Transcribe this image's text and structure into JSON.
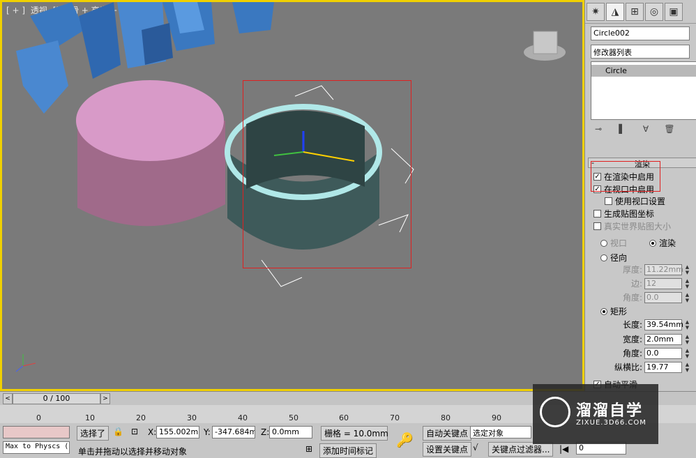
{
  "viewport": {
    "label_parts": [
      "[ + ]",
      "透视",
      "[] 平滑 + 高光 + 边面 ]"
    ],
    "colors": {
      "background": "#7a7a7a",
      "border": "#f0d000",
      "selection": "#e02020"
    }
  },
  "command_panel": {
    "tabs": [
      "create-icon",
      "modify-icon",
      "hierarchy-icon",
      "motion-icon",
      "display-icon",
      "utilities-icon"
    ],
    "object_name": "Circle002",
    "modifier_list": "修改器列表",
    "stack_items": [
      "Circle"
    ],
    "rollout_title": "渲染",
    "checkboxes": [
      {
        "label": "在渲染中启用",
        "checked": true
      },
      {
        "label": "在视口中启用",
        "checked": true
      },
      {
        "label": "使用视口设置",
        "checked": false
      },
      {
        "label": "生成贴图坐标",
        "checked": false
      },
      {
        "label": "真实世界贴图大小",
        "checked": false
      }
    ],
    "mode": {
      "viewport": "视口",
      "render": "渲染"
    },
    "radial": {
      "label": "径向",
      "thickness_label": "厚度:",
      "thickness": "11.22mm",
      "sides_label": "边:",
      "sides": "12",
      "angle_label": "角度:",
      "angle": "0.0"
    },
    "rectangular": {
      "label": "矩形",
      "length_label": "长度:",
      "length": "39.54mm",
      "width_label": "宽度:",
      "width": "2.0mm",
      "angle_label": "角度:",
      "angle": "0.0",
      "aspect_label": "纵横比:",
      "aspect": "19.77"
    },
    "auto_smooth": "自动平滑"
  },
  "timeline": {
    "frame_display": "0 / 100",
    "ruler": [
      "0",
      "10",
      "20",
      "30",
      "40",
      "50",
      "60",
      "70",
      "80",
      "90"
    ]
  },
  "status": {
    "maxscript": "Max to Physcs (",
    "selection_label": "选择了",
    "x_label": "X:",
    "x": "155.002mr",
    "y_label": "Y:",
    "y": "-347.684m",
    "z_label": "Z:",
    "z": "0.0mm",
    "grid": "栅格 = 10.0mm",
    "prompt": "单击并拖动以选择并移动对象",
    "add_time_tag": "添加时间标记",
    "auto_key": "自动关键点",
    "set_key": "设置关键点",
    "selected_object": "选定对象",
    "key_filters": "关键点过滤器...",
    "frame": "0"
  },
  "watermark": {
    "title": "溜溜自学",
    "url": "ZIXUE.3D66.COM"
  }
}
